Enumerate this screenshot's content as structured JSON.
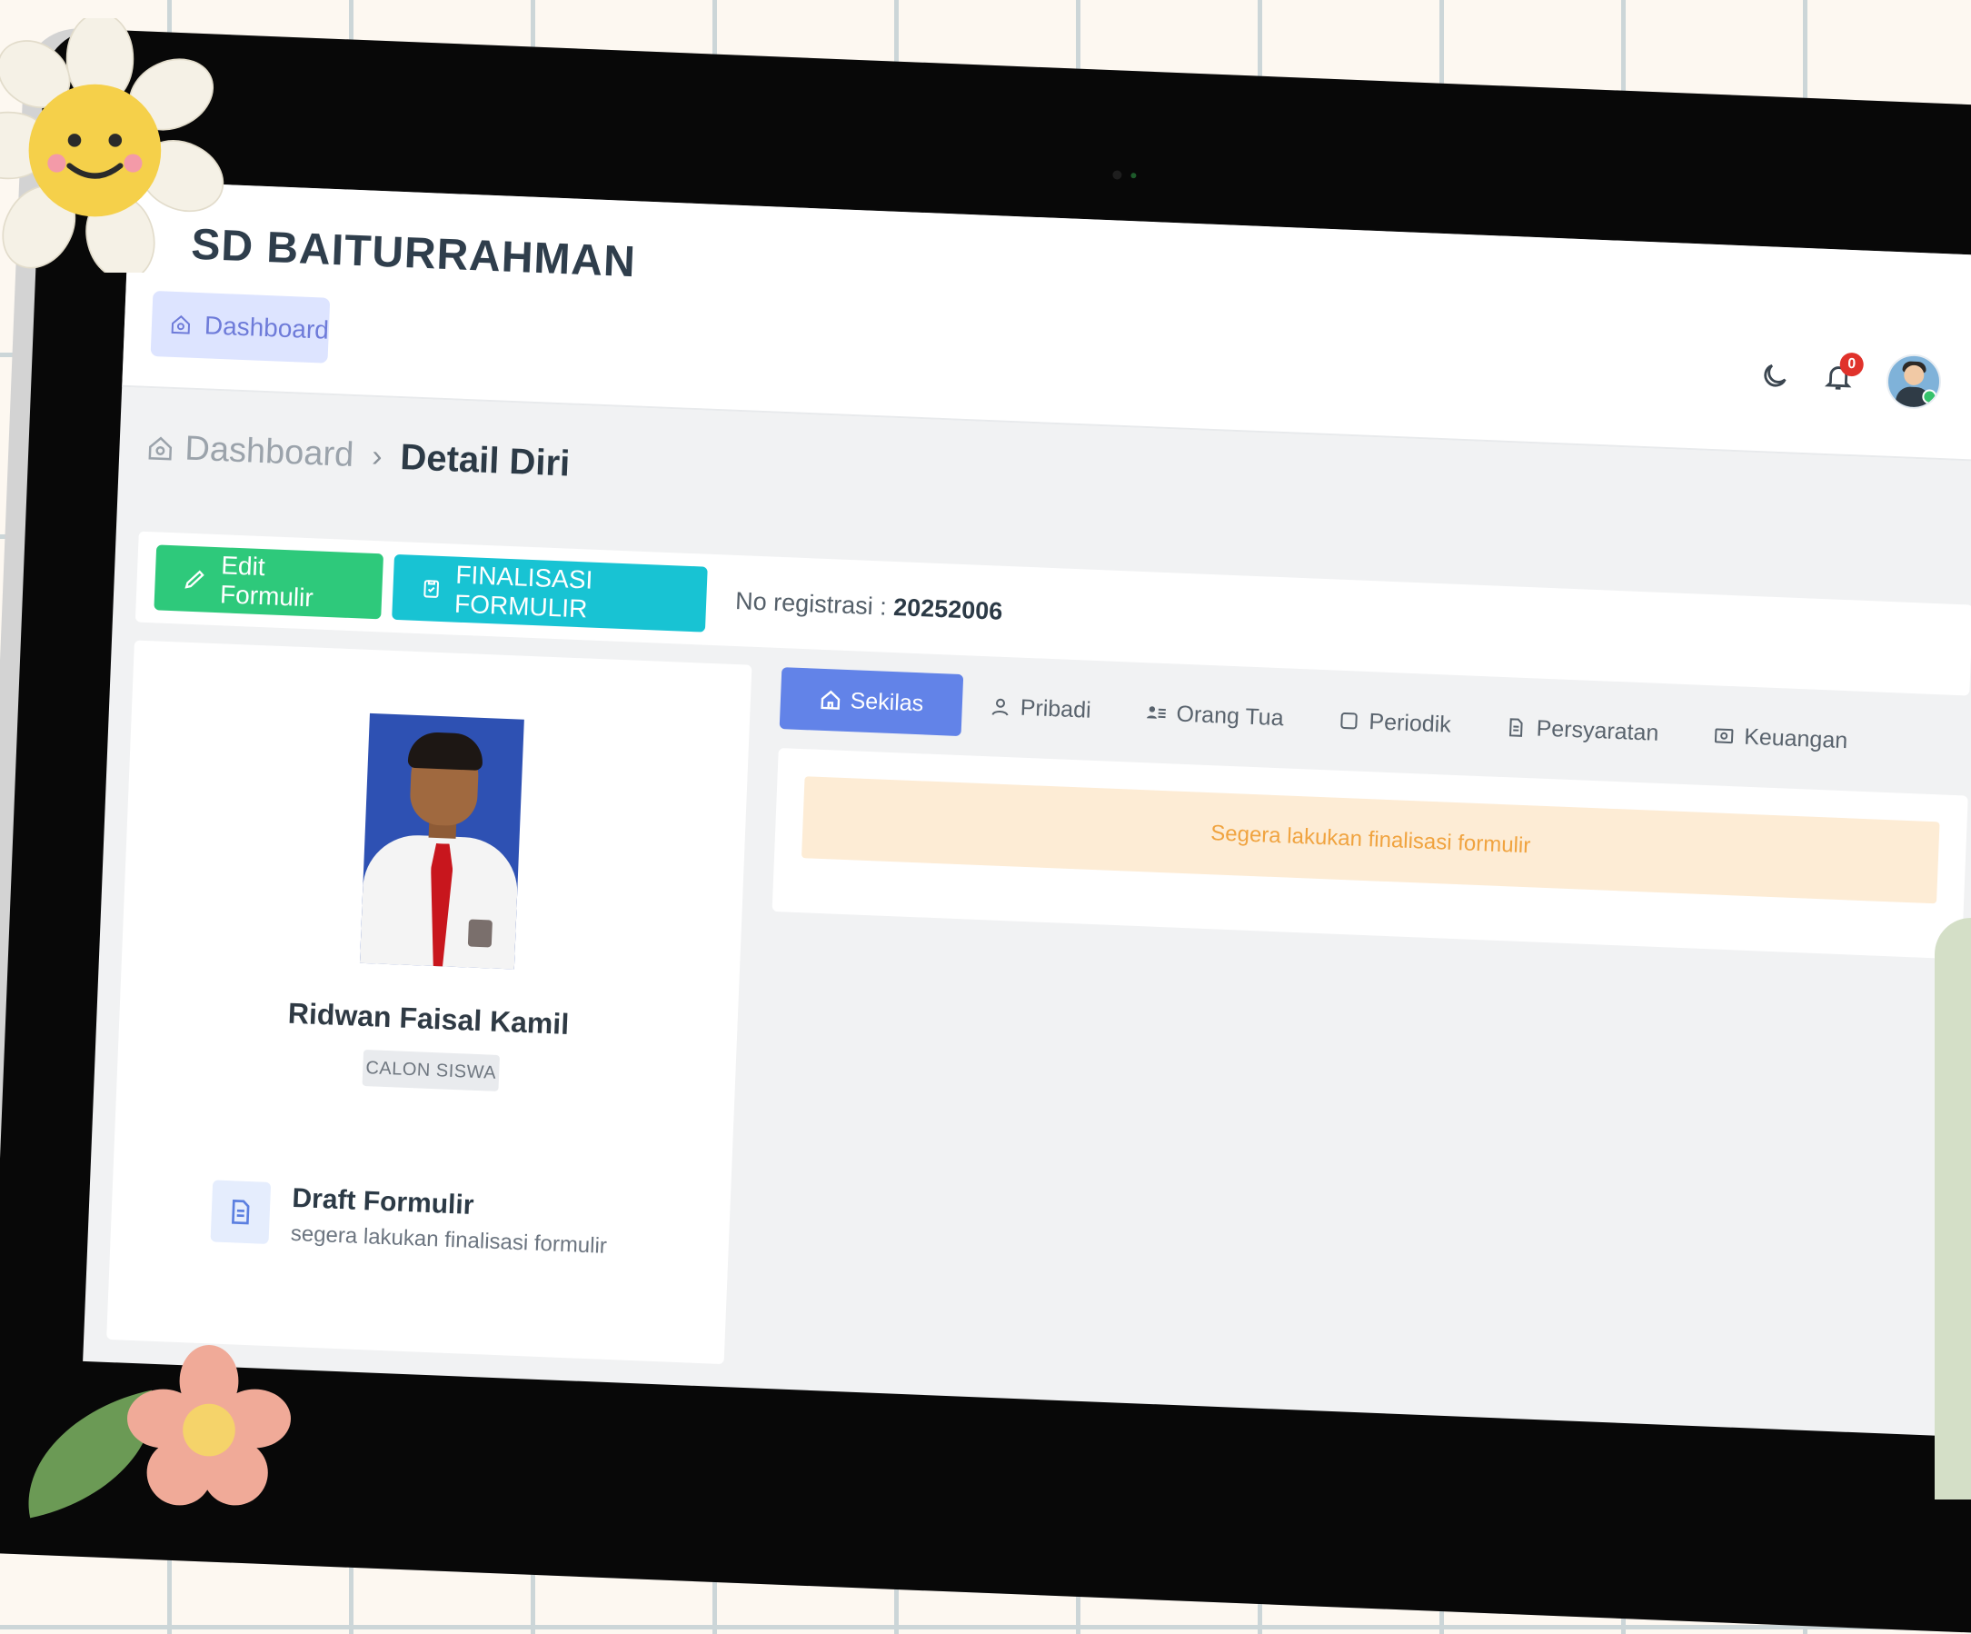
{
  "app": {
    "brand": "SD BAITURRAHMAN"
  },
  "sidebar": {
    "active_item": {
      "label": "Dashboard",
      "icon": "home-icon"
    }
  },
  "header": {
    "notification_count": "0",
    "icons": [
      "moon-icon",
      "bell-icon",
      "user-avatar"
    ]
  },
  "breadcrumb": {
    "home": "Dashboard",
    "separator": "›",
    "current": "Detail Diri"
  },
  "actions": {
    "edit_label": "Edit Formulir",
    "finalize_label": "FINALISASI FORMULIR",
    "registration_label": "No registrasi :",
    "registration_number": "20252006"
  },
  "profile": {
    "name": "Ridwan Faisal Kamil",
    "role": "CALON SISWA",
    "status_title": "Draft Formulir",
    "status_subtitle": "segera lakukan finalisasi formulir"
  },
  "tabs": [
    {
      "label": "Sekilas",
      "icon": "home-icon",
      "active": true
    },
    {
      "label": "Pribadi",
      "icon": "user-icon"
    },
    {
      "label": "Orang Tua",
      "icon": "users-list-icon"
    },
    {
      "label": "Periodik",
      "icon": "square-icon"
    },
    {
      "label": "Persyaratan",
      "icon": "document-icon"
    },
    {
      "label": "Keuangan",
      "icon": "money-icon"
    }
  ],
  "panel": {
    "alert_text": "Segera lakukan finalisasi formulir"
  },
  "colors": {
    "primary": "#6283e8",
    "success": "#2ec97b",
    "info": "#18c3d3",
    "warning_bg": "#fdecd5",
    "warning_text": "#f0a33f"
  }
}
